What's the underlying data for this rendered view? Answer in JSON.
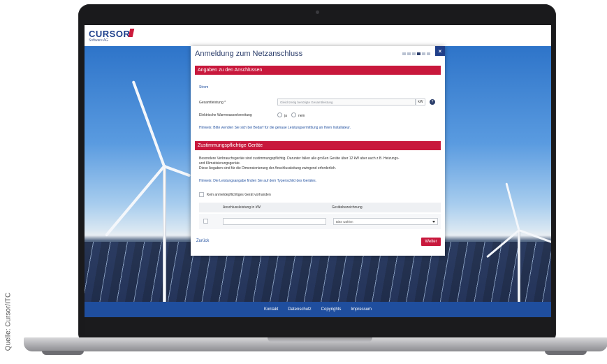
{
  "credit": "Quelle: Cursor/ITC",
  "brand": {
    "name": "CURSOR",
    "sub": "Software AG",
    "accent": "#cc1a3b"
  },
  "modal": {
    "title": "Anmeldung zum Netzanschluss",
    "steps_total": 6,
    "step_active": 4,
    "close_label": "×",
    "section1": {
      "title": "Angaben zu den Anschlüssen",
      "subsection": "Strom",
      "total_power_label": "Gesamtleistung *",
      "total_power_placeholder": "Gleichzeitig benötigte Gesamtleistung",
      "unit": "kW",
      "help": "?",
      "hotwater_label": "Elektrische Warmwasserbereitung",
      "radio_yes": "ja",
      "radio_no": "nein",
      "hint": "Hinweis: Bitte wenden Sie sich bei Bedarf für die genaue Leistungsermittlung an Ihren Installateur."
    },
    "section2": {
      "title": "Zustimmungspflichtige Geräte",
      "desc1": "Besondere Verbrauchsgeräte sind zustimmungspflichtig. Darunter fallen alle großen Geräte über 12 kW aber auch z.B. Heizungs-",
      "desc2": "und Klimatisierungsgeräte.",
      "desc3": "Diese Angaben sind für die Dimensionierung der Anschlussleitung zwingend erforderlich.",
      "hint": "Hinweis: Die Leistungsangabe finden Sie auf dem Typenschild des Gerätes.",
      "none_checkbox": "Kein anmeldepflichtiges Gerät vorhanden",
      "col1": "Anschlussleistung in kW",
      "col2": "Gerätebezeichnung",
      "select_placeholder": "Bitte wählen"
    },
    "back_label": "Zurück",
    "next_label": "Weiter"
  },
  "footer": [
    "Kontakt",
    "Datenschutz",
    "Copyrights",
    "Impressum"
  ]
}
